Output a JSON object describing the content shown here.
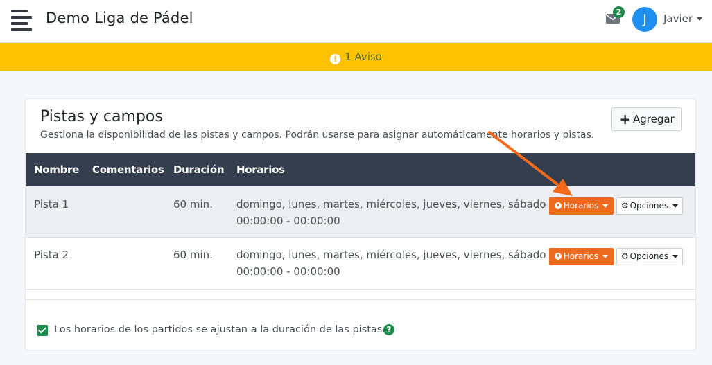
{
  "header": {
    "title": "Demo Liga de Pádel",
    "mail_count": "2",
    "user_initial": "J",
    "user_name": "Javier"
  },
  "alert": {
    "icon": "!",
    "text": "1 Aviso"
  },
  "card": {
    "title": "Pistas y campos",
    "subtitle": "Gestiona la disponibilidad de las pistas y campos. Podrán usarse para asignar automáticamente horarios y pistas.",
    "add_label": "Agregar",
    "columns": [
      "Nombre",
      "Comentarios",
      "Duración",
      "Horarios"
    ],
    "rows": [
      {
        "name": "Pista 1",
        "comments": "",
        "duration": "60 min.",
        "days": "domingo, lunes, martes, miércoles, jueves, viernes, sábado",
        "hours": "00:00:00 - 00:00:00",
        "schedule_btn": "Horarios",
        "options_btn": "Opciones"
      },
      {
        "name": "Pista 2",
        "comments": "",
        "duration": "60 min.",
        "days": "domingo, lunes, martes, miércoles, jueves, viernes, sábado",
        "hours": "00:00:00 - 00:00:00",
        "schedule_btn": "Horarios",
        "options_btn": "Opciones"
      }
    ],
    "checkbox_label": "Los horarios de los partidos se ajustan a la duración de las pistas.",
    "checkbox_checked": true,
    "help_icon": "?"
  },
  "colors": {
    "accent_orange": "#ee6a1f",
    "warning": "#fcc200",
    "header_dark": "#343e4f",
    "success": "#1e8a4c",
    "avatar_blue": "#1f8ff0"
  },
  "icons": [
    "hamburger-icon",
    "envelope-icon",
    "exclamation-icon",
    "plus-icon",
    "clock-icon",
    "gear-icon",
    "caret-down-icon",
    "check-icon",
    "question-icon",
    "annotation-arrow"
  ]
}
